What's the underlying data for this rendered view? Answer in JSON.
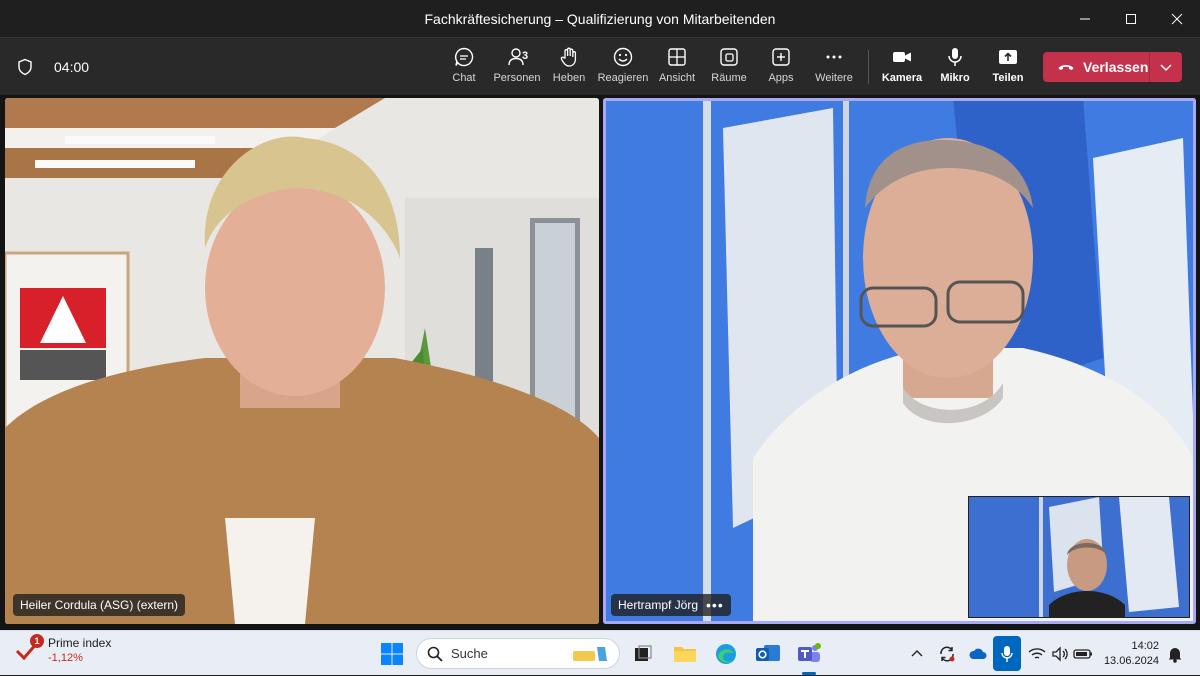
{
  "window": {
    "title": "Fachkräftesicherung – Qualifizierung von Mitarbeitenden"
  },
  "toolbar": {
    "timer": "04:00",
    "buttons": [
      {
        "id": "chat",
        "label": "Chat",
        "icon": "chat-icon"
      },
      {
        "id": "people",
        "label": "Personen",
        "icon": "people-icon",
        "count": "3"
      },
      {
        "id": "raise",
        "label": "Heben",
        "icon": "raise-hand-icon"
      },
      {
        "id": "react",
        "label": "Reagieren",
        "icon": "smiley-icon"
      },
      {
        "id": "view",
        "label": "Ansicht",
        "icon": "view-grid-icon"
      },
      {
        "id": "rooms",
        "label": "Räume",
        "icon": "rooms-icon"
      },
      {
        "id": "apps",
        "label": "Apps",
        "icon": "apps-plus-icon"
      },
      {
        "id": "more",
        "label": "Weitere",
        "icon": "more-icon"
      },
      {
        "id": "camera",
        "label": "Kamera",
        "icon": "camera-icon"
      },
      {
        "id": "mic",
        "label": "Mikro",
        "icon": "microphone-icon"
      },
      {
        "id": "share",
        "label": "Teilen",
        "icon": "share-icon"
      }
    ],
    "leave_label": "Verlassen",
    "leave_color": "#c4314b"
  },
  "participants": [
    {
      "name": "Heiler Cordula (ASG) (extern)"
    },
    {
      "name": "Hertrampf Jörg"
    }
  ],
  "taskbar": {
    "widget": {
      "title": "Prime index",
      "value": "-1,12%",
      "badge": "1"
    },
    "search_placeholder": "Suche",
    "clock": {
      "time": "14:02",
      "date": "13.06.2024"
    }
  },
  "colors": {
    "accent": "#0067c0",
    "active_speaker": "#a7a9f5"
  }
}
